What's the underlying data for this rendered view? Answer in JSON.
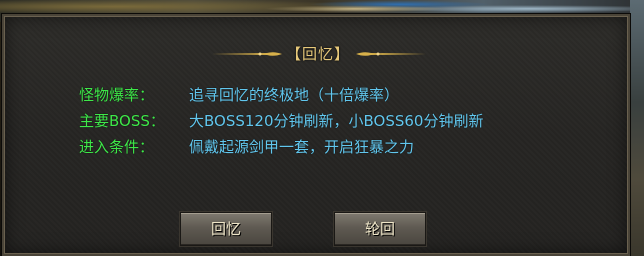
{
  "dialog": {
    "title": "【回忆】",
    "rows": [
      {
        "label": "怪物爆率：",
        "value": "追寻回忆的终极地（十倍爆率）"
      },
      {
        "label": "主要BOSS：",
        "value": "大BOSS120分钟刷新，小BOSS60分钟刷新"
      },
      {
        "label": "进入条件：",
        "value": "佩戴起源剑甲一套，开启狂暴之力"
      }
    ],
    "buttons": {
      "recall": "回忆",
      "reincarnate": "轮回"
    }
  },
  "colors": {
    "label": "#3fe84a",
    "value": "#62c7ee",
    "title": "#e7c97a"
  }
}
